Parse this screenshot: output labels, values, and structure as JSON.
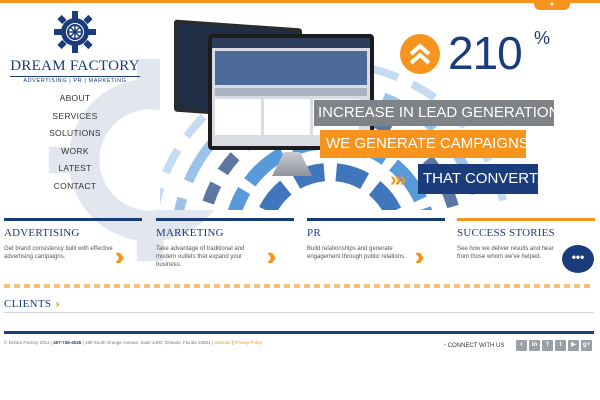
{
  "brand": {
    "name": "DREAM FACTORY",
    "tagline": "ADVERTISING | PR | MARKETING",
    "color_primary": "#1a3c7a",
    "color_accent": "#f7941d"
  },
  "top_tab": {
    "label": "+"
  },
  "nav": {
    "items": [
      {
        "label": "ABOUT"
      },
      {
        "label": "SERVICES"
      },
      {
        "label": "SOLUTIONS"
      },
      {
        "label": "WORK"
      },
      {
        "label": "LATEST"
      },
      {
        "label": "CONTACT"
      }
    ]
  },
  "hero": {
    "stat_value": "210",
    "stat_unit": "%",
    "line1": "INCREASE IN LEAD GENERATION",
    "line2": "WE GENERATE CAMPAIGNS",
    "line3": "THAT CONVERT."
  },
  "services": [
    {
      "title": "ADVERTISING",
      "desc": "Get brand consistency built with effective advertising campaigns."
    },
    {
      "title": "MARKETING",
      "desc": "Take advantage of traditional and modern outlets that expand your business."
    },
    {
      "title": "PR",
      "desc": "Build relationships and generate engagement through public relations."
    },
    {
      "title": "SUCCESS STORIES",
      "desc": "See how we deliver results and hear from those whom we've helped."
    }
  ],
  "clients": {
    "label": "CLIENTS"
  },
  "footer": {
    "copyright": "© Dream Factory 2014 |",
    "phone": "407-745-4045",
    "address": "| 189 South Orange Avenue, Suite 1400, Orlando, Florida 32801 |",
    "sitemap": "Sitemap",
    "separator": "|",
    "privacy": "Privacy Policy",
    "connect_label": "CONNECT WITH US",
    "social_icons": [
      "rss-icon",
      "linkedin-icon",
      "facebook-icon",
      "twitter-icon",
      "youtube-icon",
      "googleplus-icon"
    ]
  }
}
